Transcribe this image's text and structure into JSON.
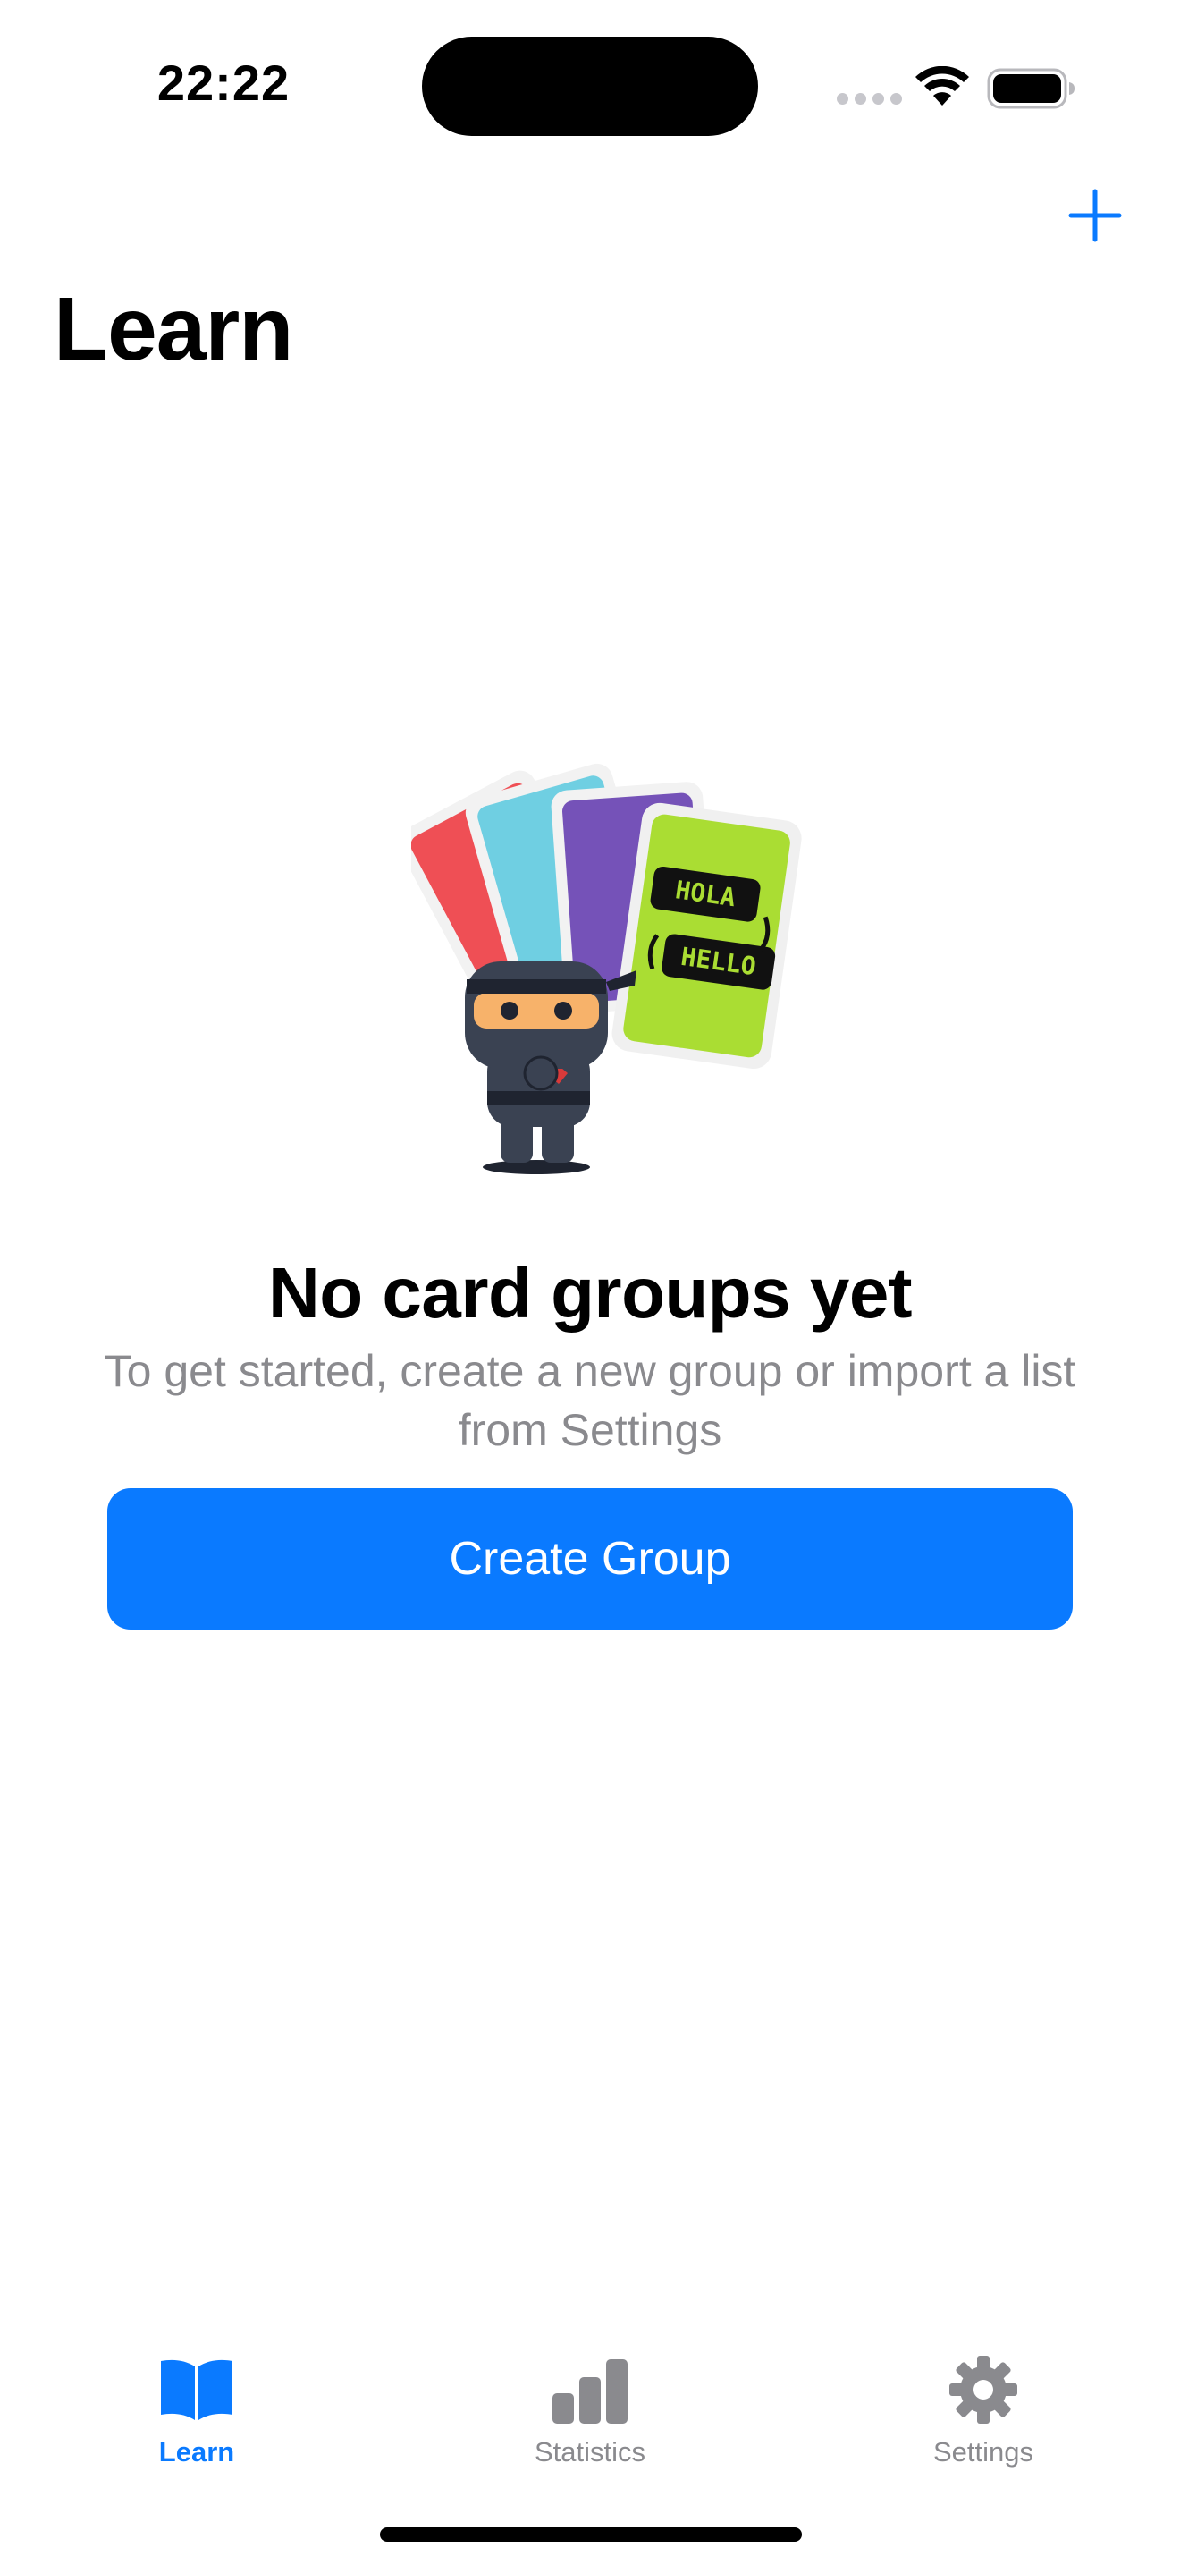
{
  "status_bar": {
    "time": "22:22"
  },
  "nav": {
    "add_icon": "plus-icon",
    "title": "Learn"
  },
  "illustration": {
    "card_top": "HOLA",
    "card_bottom": "HELLO"
  },
  "empty_state": {
    "title": "No card groups yet",
    "subtitle": "To get started, create a new group or import a list from Settings",
    "button_label": "Create Group"
  },
  "tabs": [
    {
      "label": "Learn",
      "icon": "book-icon",
      "active": true
    },
    {
      "label": "Statistics",
      "icon": "chart-icon",
      "active": false
    },
    {
      "label": "Settings",
      "icon": "gear-icon",
      "active": false
    }
  ],
  "colors": {
    "accent": "#0a7aff",
    "secondary_text": "#8a8a8e",
    "inactive_icon": "#8a8a8e"
  }
}
